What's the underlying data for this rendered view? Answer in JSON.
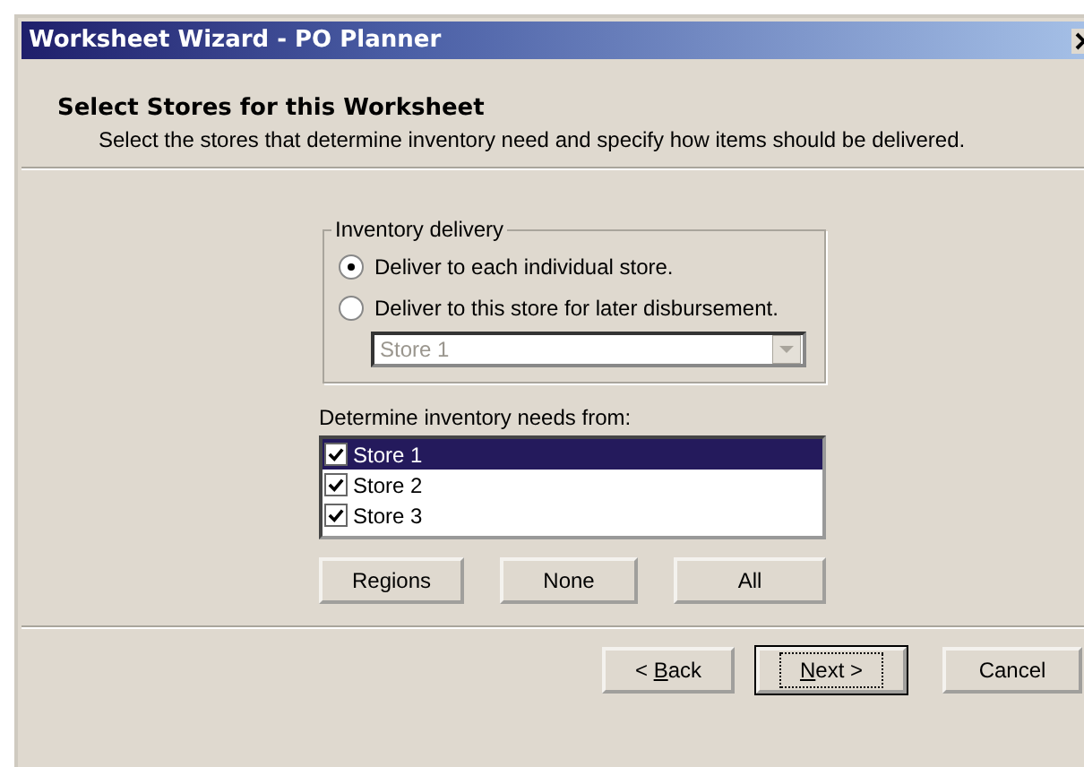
{
  "window": {
    "title": "Worksheet Wizard - PO Planner"
  },
  "header": {
    "title": "Select Stores for this Worksheet",
    "subtitle": "Select the stores that determine inventory need and specify how items should be delivered."
  },
  "inventory_delivery": {
    "legend": "Inventory delivery",
    "options": [
      {
        "label": "Deliver to each individual store.",
        "selected": true
      },
      {
        "label": "Deliver to this store for later disbursement.",
        "selected": false
      }
    ],
    "store_dropdown": {
      "value": "Store 1",
      "disabled": true
    }
  },
  "stores": {
    "label": "Determine inventory needs from:",
    "items": [
      {
        "label": "Store 1",
        "checked": true,
        "selected": true
      },
      {
        "label": "Store 2",
        "checked": true,
        "selected": false
      },
      {
        "label": "Store 3",
        "checked": true,
        "selected": false
      }
    ]
  },
  "list_buttons": [
    "Regions",
    "None",
    "All"
  ],
  "footer_buttons": [
    {
      "before": "< ",
      "key": "B",
      "after": "ack",
      "default": false
    },
    {
      "key": "N",
      "after": "ext >",
      "default": true
    },
    {
      "before": "Cancel",
      "default": false
    }
  ]
}
